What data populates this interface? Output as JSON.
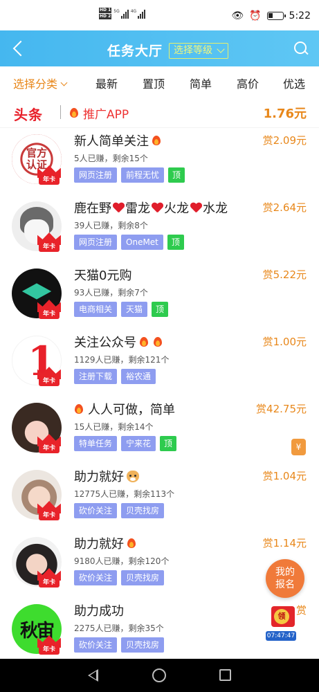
{
  "status_bar": {
    "hd1": "HD 1",
    "hd2": "HD 2",
    "net1": "5G",
    "net2": "4G",
    "time": "5:22"
  },
  "header": {
    "title": "任务大厅",
    "level_select": "选择等级"
  },
  "tabs": {
    "category": "选择分类",
    "items": [
      "最新",
      "置顶",
      "简单",
      "高价",
      "优选"
    ]
  },
  "promo": {
    "brand": "头条",
    "label": "推广APP",
    "reward": "1.76元"
  },
  "tasks": [
    {
      "title": "新人简单关注",
      "stats": "5人已赚，剩余15个",
      "tags": [
        "网页注册",
        "前程无忧"
      ],
      "top": "顶",
      "reward": "赏2.09元",
      "avatar_text": "官方认证",
      "badge": "年卡"
    },
    {
      "title_parts": [
        "鹿在野",
        "雷龙",
        "火龙",
        "水龙"
      ],
      "stats": "39人已赚，剩余8个",
      "tags": [
        "网页注册",
        "OneMet"
      ],
      "top": "顶",
      "reward": "赏2.64元",
      "badge": "年卡"
    },
    {
      "title": "天猫0元购",
      "stats": "93人已赚，剩余7个",
      "tags": [
        "电商相关",
        "天猫"
      ],
      "top": "顶",
      "reward": "赏5.22元",
      "badge": "年卡"
    },
    {
      "title": "关注公众号",
      "stats": "1129人已赚，剩余121个",
      "tags": [
        "注册下载",
        "裕农通"
      ],
      "reward": "赏1.00元",
      "avatar_text": "1",
      "badge": "年卡"
    },
    {
      "title": "人人可做，简单",
      "stats": "15人已赚，剩余14个",
      "tags": [
        "特单任务",
        "宁来花"
      ],
      "top": "顶",
      "reward": "赏42.75元",
      "cash": "¥",
      "badge": "年卡"
    },
    {
      "title": "助力就好",
      "stats": "12775人已赚，剩余113个",
      "tags": [
        "砍价关注",
        "贝壳找房"
      ],
      "reward": "赏1.04元",
      "badge": "年卡"
    },
    {
      "title": "助力就好",
      "stats": "9180人已赚，剩余120个",
      "tags": [
        "砍价关注",
        "贝壳找房"
      ],
      "reward": "赏1.14元",
      "badge": "年卡"
    },
    {
      "title": "助力成功",
      "stats": "2275人已赚，剩余35个",
      "tags": [
        "砍价关注",
        "贝壳找房"
      ],
      "reward": "赏",
      "avatar_text": "秋宙",
      "badge": "年卡"
    }
  ],
  "floating": {
    "my_signup_line1": "我的",
    "my_signup_line2": "报名",
    "redpacket_label": "领",
    "redpacket_timer": "07:47:47"
  },
  "colors": {
    "header_bg": "#45b7ef",
    "accent_orange": "#e8871a",
    "tag_blue": "#8e9df0",
    "tag_green": "#2ecb4e",
    "brand_red": "#e8202a"
  },
  "icons": [
    "back-icon",
    "search-icon",
    "chevron-down-icon",
    "flame-icon",
    "heart-icon",
    "dog-icon",
    "cash-icon",
    "nav-back-icon",
    "nav-home-icon",
    "nav-recent-icon"
  ]
}
